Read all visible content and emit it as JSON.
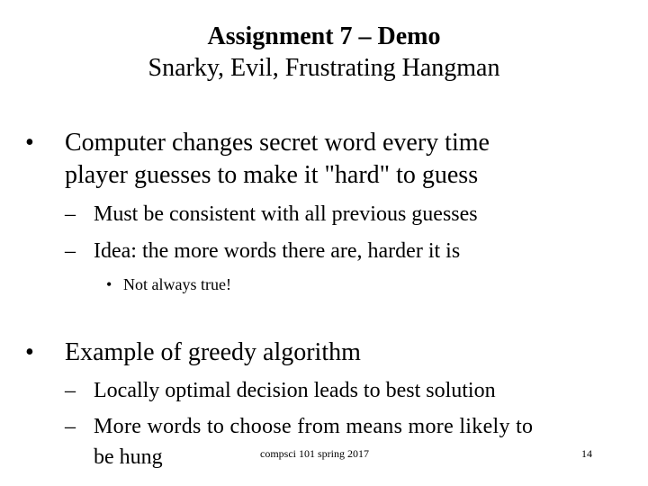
{
  "slide": {
    "title": "Assignment  7 – Demo",
    "subtitle": "Snarky, Evil, Frustrating Hangman",
    "bullets": [
      {
        "text_line1": "Computer changes secret word every time",
        "text_line2": "player guesses to make it \"hard\" to guess",
        "sub": [
          "Must be consistent with all previous guesses",
          "Idea: the more words there are, harder it is"
        ],
        "subsub": [
          "Not always true!"
        ]
      },
      {
        "text": "Example of greedy algorithm",
        "sub": [
          "Locally optimal decision leads to best solution",
          "More words to choose from means more likely to",
          "be hung"
        ]
      }
    ],
    "markers": {
      "level1": "•",
      "level2": "–",
      "level3": "•"
    },
    "footer": {
      "course": "compsci 101 spring 2017",
      "page_number": "14"
    }
  }
}
